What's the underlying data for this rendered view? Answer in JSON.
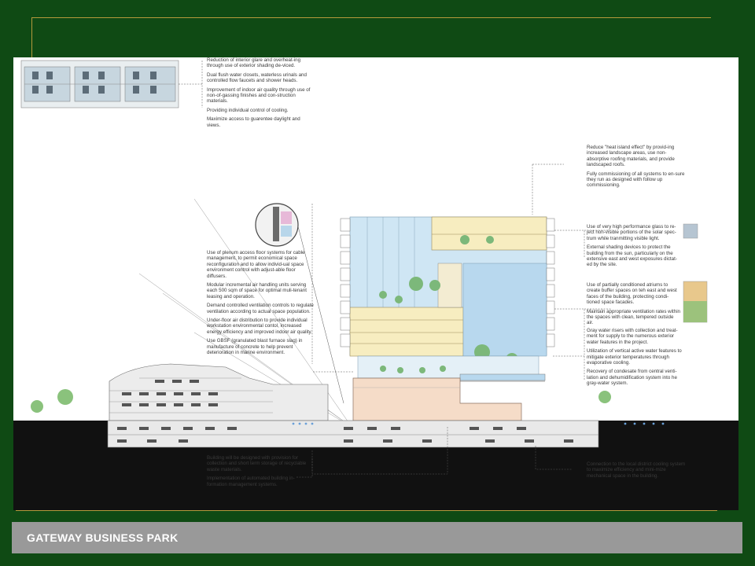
{
  "slide": {
    "footer_title": "GATEWAY BUSINESS PARK"
  },
  "notes": {
    "top_left": [
      "Reduction of interior glare and overheat-ing through use of exterior shading de-viced.",
      "Dual flush water closets, waterless urinals and controlled flow faucets and shower heads.",
      "Improvement of indoor air quality through use of non-of-gassing finishes and con-struction materials.",
      "Providing individual control of cooling.",
      "Maximize access to guarentee daylight and views."
    ],
    "left_mid": [
      "Use of plenum access floor systems for cable management, to permit economical space reconfiguration and to allow individ-ual space environment control with adjust-able floor diffusers.",
      "Modular incremental air handling units serving each 500 sqm of space for optimal muli-tenant leasing and operation.",
      "Demand controlled ventilation controls to regulate ventilation according to actual space population.",
      "Under-floor air distribution to provide individual workstation environmental contol, increased energy efficiency and improved indoor air quality.",
      "Use GBSF (granulated blast furnace slag) in manufacture of concrete to help prevent deterioration in marine environment."
    ],
    "right_top": [
      "Reduce \"heat island effect\" by provid-ing increased landscape areas, use non-absorptive roofing materials, and provide landscaped roofs.",
      "Fully commissioning of all systems to en-sure they run as designed with follow up commissioning."
    ],
    "right_glass": [
      "Use of very high performance glass to re-ject non-visible portions of the solar spec-trum while tranmitting visible light.",
      "External shading devices to protect the building from the sun, particularly on the extensive east and west exposures dictat-ed by the site."
    ],
    "right_atrium": [
      "Use of partially conditioned atriums to create buffer spaces on teh east and west faces of the building, protecting condi-tioned space facades.",
      "Maintain appropriate ventilation rates within the spaces with clean, tempered outside air."
    ],
    "right_water": [
      "Gray water risers with collection and treat-ment for supply to the numerous exterior water features in the project.",
      "Utilization of vertical active water features to mitigate exterior temperatures through evaporative cooling.",
      "Recovery of condesate from central venti-lation and dehumidification system into he gray-water system."
    ],
    "bottom_left": [
      "Building will be designed with provision for collection and short term storage of recyclable waste materials.",
      "Implementation of automated building in-formation management systems."
    ],
    "bottom_right": [
      "Connection to the local district cooling system to maximize efficiency and mini-mize mechanical space in the building."
    ]
  },
  "colors": {
    "background": "#0f4a14",
    "frame_line": "#b59a3c",
    "footer_bar": "#999999",
    "ground": "#111111",
    "glass": "#cfe6f4",
    "floor_plate": "#f7edc0",
    "podium": "#f5dcc8"
  }
}
